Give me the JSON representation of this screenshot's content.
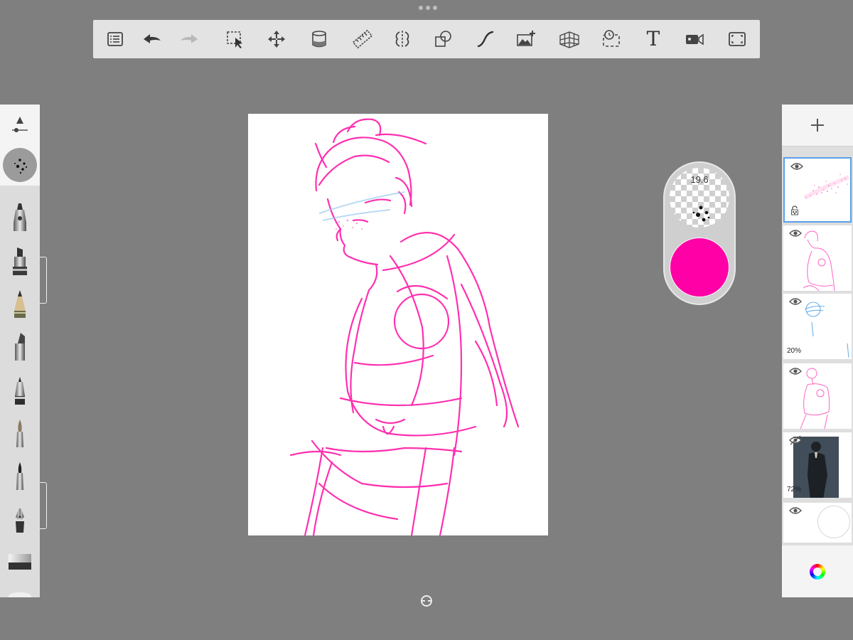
{
  "app": {
    "accent_color": "#ff00a6",
    "background_color": "#7f7f7f"
  },
  "toolbar": {
    "tools": [
      {
        "id": "list",
        "icon": "list-icon"
      },
      {
        "id": "undo",
        "icon": "undo-arrow-icon"
      },
      {
        "id": "redo",
        "icon": "redo-arrow-icon",
        "enabled": false
      },
      {
        "id": "selection",
        "icon": "selection-icon"
      },
      {
        "id": "transform",
        "icon": "move-icon"
      },
      {
        "id": "fill",
        "icon": "fill-bucket-icon"
      },
      {
        "id": "ruler",
        "icon": "ruler-icon"
      },
      {
        "id": "symmetry",
        "icon": "symmetry-icon"
      },
      {
        "id": "shapes",
        "icon": "shapes-icon"
      },
      {
        "id": "curve",
        "icon": "curve-icon"
      },
      {
        "id": "add-image",
        "icon": "add-image-icon"
      },
      {
        "id": "perspective",
        "icon": "perspective-grid-icon"
      },
      {
        "id": "timelapse",
        "icon": "timelapse-icon"
      },
      {
        "id": "text",
        "icon": "text-icon",
        "label": "T"
      },
      {
        "id": "record",
        "icon": "video-icon"
      },
      {
        "id": "fullscreen",
        "icon": "fullscreen-icon"
      }
    ]
  },
  "brush_palette": {
    "brushes": [
      {
        "name": "airbrush",
        "icon": "airbrush-icon"
      },
      {
        "name": "marker",
        "icon": "marker-icon"
      },
      {
        "name": "pencil",
        "icon": "pencil-icon"
      },
      {
        "name": "chisel-marker",
        "icon": "chisel-marker-icon"
      },
      {
        "name": "ballpoint-pen",
        "icon": "ballpoint-pen-icon"
      },
      {
        "name": "paintbrush",
        "icon": "paintbrush-icon"
      },
      {
        "name": "ink-brush",
        "icon": "ink-brush-icon"
      },
      {
        "name": "fountain-pen",
        "icon": "fountain-pen-icon"
      },
      {
        "name": "eraser",
        "icon": "eraser-icon"
      }
    ]
  },
  "puck": {
    "brush_size": "19.6",
    "color": "#ff00a6"
  },
  "layers": {
    "items": [
      {
        "name": "layer-1",
        "opacity_label": "",
        "visible": true,
        "locked": true,
        "selected": true
      },
      {
        "name": "layer-2",
        "opacity_label": "",
        "visible": true,
        "locked": false,
        "selected": false
      },
      {
        "name": "layer-3",
        "opacity_label": "20%",
        "visible": true,
        "locked": false,
        "selected": false
      },
      {
        "name": "layer-4",
        "opacity_label": "",
        "visible": true,
        "locked": false,
        "selected": false
      },
      {
        "name": "layer-5",
        "opacity_label": "72%",
        "visible": false,
        "locked": false,
        "selected": false
      },
      {
        "name": "background-layer",
        "opacity_label": "",
        "visible": true,
        "locked": false,
        "selected": false
      }
    ]
  }
}
